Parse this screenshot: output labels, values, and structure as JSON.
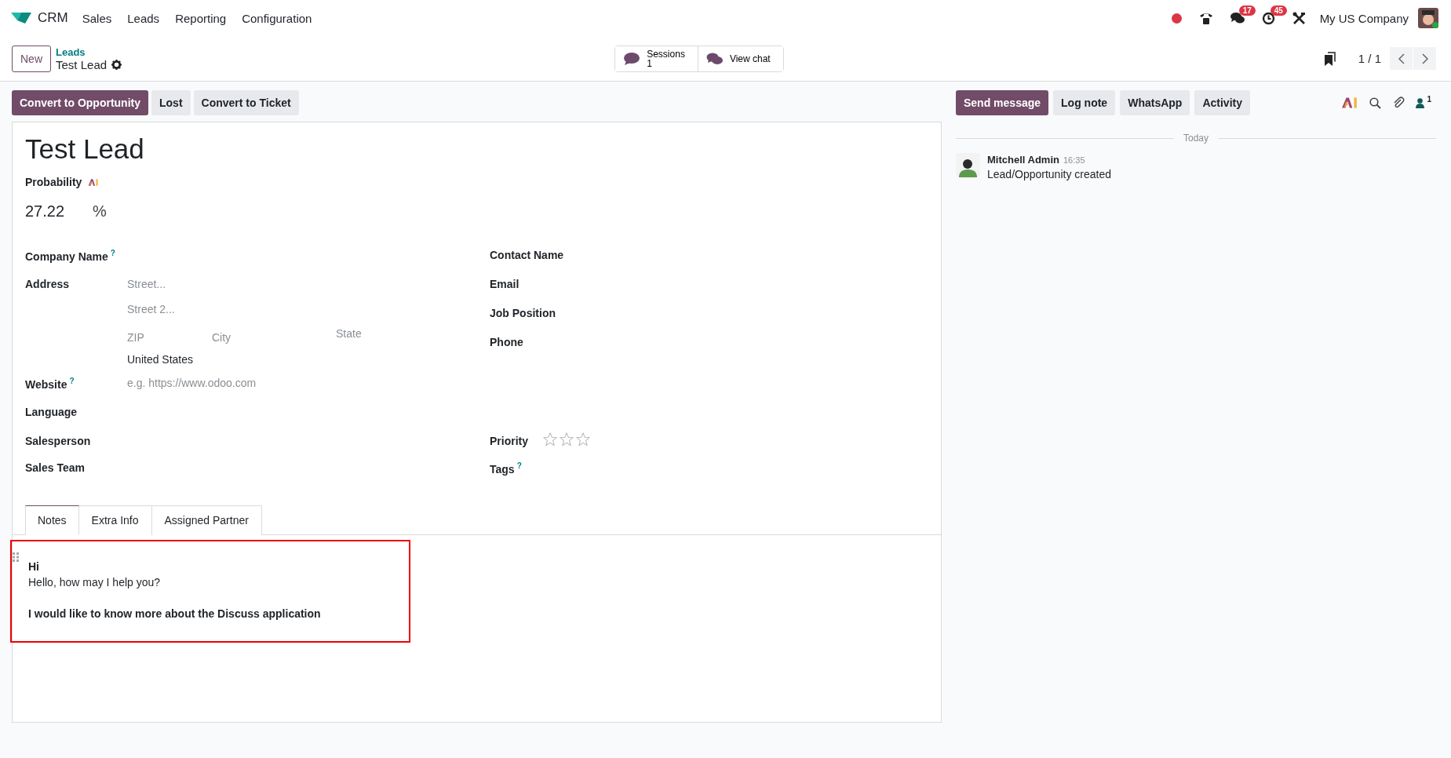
{
  "navbar": {
    "app": "CRM",
    "menus": [
      "Sales",
      "Leads",
      "Reporting",
      "Configuration"
    ],
    "systray": [
      {
        "kind": "recording"
      },
      {
        "kind": "phone"
      },
      {
        "kind": "messages",
        "badge": "17"
      },
      {
        "kind": "activities",
        "badge": "45"
      },
      {
        "kind": "tools"
      }
    ],
    "company": "My US Company"
  },
  "control_panel": {
    "new_button": "New",
    "breadcrumb": "Leads",
    "record": "Test Lead",
    "chat_buttons": [
      {
        "label": "Sessions",
        "count": "1"
      },
      {
        "label": "View chat"
      }
    ],
    "pager": "1 / 1"
  },
  "status_buttons": [
    {
      "label": "Convert to Opportunity",
      "primary": true
    },
    {
      "label": "Lost",
      "primary": false
    },
    {
      "label": "Convert to Ticket",
      "primary": false
    }
  ],
  "form": {
    "title": "Test Lead",
    "probability": {
      "label": "Probability",
      "value": "27.22",
      "unit": "%"
    },
    "sections": [
      {
        "left": [
          {
            "kind": "text",
            "label": "Company Name",
            "help": "?"
          },
          {
            "kind": "address",
            "label": "Address",
            "inputs": [
              {
                "placeholder": "Street..."
              },
              {
                "placeholder": "Street 2..."
              },
              {
                "placeholder": "ZIP"
              },
              {
                "placeholder": "City"
              },
              {
                "placeholder": "State"
              }
            ],
            "country": "United States"
          },
          {
            "kind": "placeholder",
            "label": "Website",
            "help": "?",
            "placeholder": "e.g. https://www.odoo.com"
          },
          {
            "kind": "text",
            "label": "Language"
          }
        ],
        "right": [
          {
            "kind": "text",
            "label": "Contact Name"
          },
          {
            "kind": "text",
            "label": "Email"
          },
          {
            "kind": "text",
            "label": "Job Position"
          },
          {
            "kind": "text",
            "label": "Phone"
          }
        ]
      },
      {
        "left": [
          {
            "kind": "text",
            "label": "Salesperson"
          },
          {
            "kind": "text",
            "label": "Sales Team"
          }
        ],
        "right": [
          {
            "kind": "priority",
            "label": "Priority",
            "stars": 0
          },
          {
            "kind": "text",
            "label": "Tags",
            "help": "?"
          }
        ]
      }
    ],
    "tabs": [
      {
        "label": "Notes",
        "selected": true
      },
      {
        "label": "Extra Info",
        "selected": false
      },
      {
        "label": "Assigned Partner",
        "selected": false
      }
    ],
    "notes": {
      "highlighted": true,
      "paragraphs": [
        {
          "lines": [
            {
              "text": "Hi",
              "bold": true
            },
            {
              "text": "Hello, how may I help you?",
              "bold": false
            }
          ]
        },
        {
          "lines": [
            {
              "text": "I would like to know more about the Discuss application",
              "bold": true
            }
          ]
        }
      ]
    }
  },
  "chatter": {
    "buttons": [
      {
        "label": "Send message",
        "primary": true
      },
      {
        "label": "Log note",
        "primary": false
      },
      {
        "label": "WhatsApp",
        "primary": false
      },
      {
        "label": "Activity",
        "primary": false
      }
    ],
    "followers": "1",
    "date": "Today",
    "messages": [
      {
        "author": "Mitchell Admin",
        "time": "16:35",
        "text": "Lead/Opportunity created"
      }
    ]
  }
}
